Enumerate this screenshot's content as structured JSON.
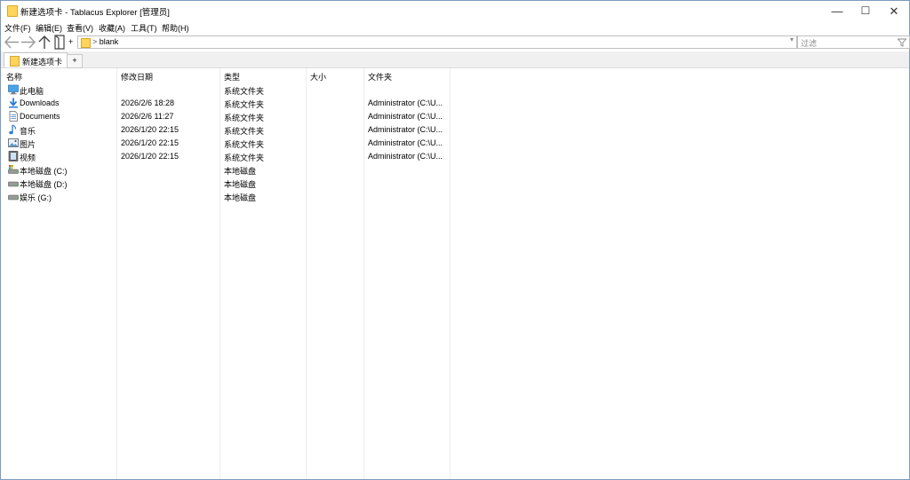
{
  "window": {
    "title": "新建选项卡 - Tablacus Explorer [管理员]",
    "controls": {
      "minimize": "—",
      "maximize": "☐",
      "close": "✕"
    }
  },
  "menu": [
    "文件(F)",
    "编辑(E)",
    "查看(V)",
    "收藏(A)",
    "工具(T)",
    "帮助(H)"
  ],
  "nav": {
    "new_tab_plus": "+",
    "address": "blank",
    "address_sep": ">",
    "address_dropdown": "▾",
    "filter_placeholder": "过滤",
    "filter_icon": "funnel-icon"
  },
  "tabs": {
    "items": [
      {
        "label": "新建选项卡"
      }
    ],
    "add_label": "+"
  },
  "columns": [
    "名称",
    "修改日期",
    "类型",
    "大小",
    "文件夹"
  ],
  "rows": [
    {
      "name": "此电脑",
      "date": "",
      "type": "系统文件夹",
      "size": "",
      "folder": "",
      "icon": "computer-icon"
    },
    {
      "name": "Downloads",
      "date": "2026/2/6 18:28",
      "type": "系统文件夹",
      "size": "",
      "folder": "Administrator (C:\\U...",
      "icon": "download-icon"
    },
    {
      "name": "Documents",
      "date": "2026/2/6 11:27",
      "type": "系统文件夹",
      "size": "",
      "folder": "Administrator (C:\\U...",
      "icon": "document-icon"
    },
    {
      "name": "音乐",
      "date": "2026/1/20 22:15",
      "type": "系统文件夹",
      "size": "",
      "folder": "Administrator (C:\\U...",
      "icon": "music-icon"
    },
    {
      "name": "图片",
      "date": "2026/1/20 22:15",
      "type": "系统文件夹",
      "size": "",
      "folder": "Administrator (C:\\U...",
      "icon": "picture-icon"
    },
    {
      "name": "视频",
      "date": "2026/1/20 22:15",
      "type": "系统文件夹",
      "size": "",
      "folder": "Administrator (C:\\U...",
      "icon": "video-icon"
    },
    {
      "name": "本地磁盘 (C:)",
      "date": "",
      "type": "本地磁盘",
      "size": "",
      "folder": "",
      "icon": "drive-c-icon"
    },
    {
      "name": "本地磁盘 (D:)",
      "date": "",
      "type": "本地磁盘",
      "size": "",
      "folder": "",
      "icon": "drive-icon"
    },
    {
      "name": "娱乐 (G:)",
      "date": "",
      "type": "本地磁盘",
      "size": "",
      "folder": "",
      "icon": "drive-icon"
    }
  ]
}
